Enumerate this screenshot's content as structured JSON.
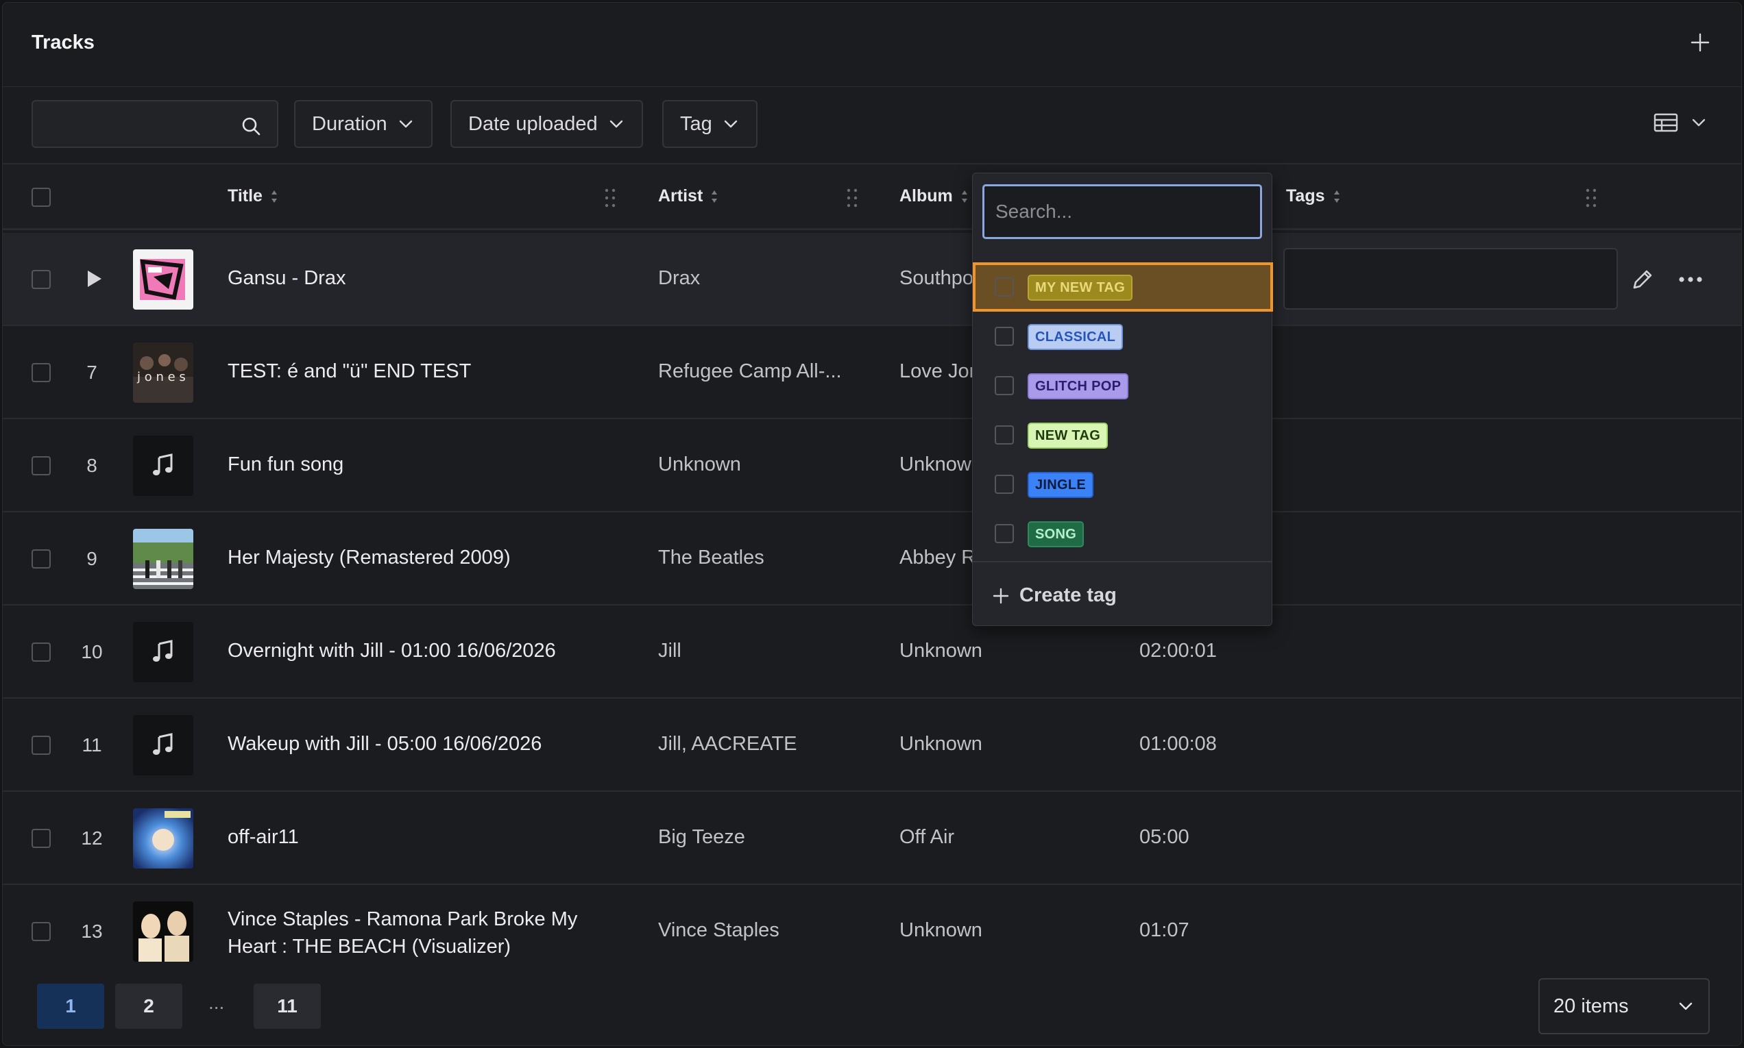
{
  "header": {
    "title": "Tracks"
  },
  "filters": {
    "search_placeholder": "",
    "duration_label": "Duration",
    "date_label": "Date uploaded",
    "tag_label": "Tag"
  },
  "columns": {
    "title": "Title",
    "artist": "Artist",
    "album": "Album",
    "tags": "Tags"
  },
  "rows": [
    {
      "num": "",
      "title": "Gansu - Drax",
      "artist": "Drax",
      "album": "Southpo",
      "duration": "",
      "thumb": "art-pink"
    },
    {
      "num": "7",
      "title": "TEST: é and \"ü\" END TEST",
      "artist": "Refugee Camp All-...",
      "album": "Love Jon",
      "duration": "",
      "thumb": "art-jones"
    },
    {
      "num": "8",
      "title": "Fun fun song",
      "artist": "Unknown",
      "album": "Unknow",
      "duration": "",
      "thumb": "note"
    },
    {
      "num": "9",
      "title": "Her Majesty (Remastered 2009)",
      "artist": "The Beatles",
      "album": "Abbey R",
      "duration": "",
      "thumb": "art-abbey"
    },
    {
      "num": "10",
      "title": "Overnight with Jill - 01:00 16/06/2026",
      "artist": "Jill",
      "album": "Unknown",
      "duration": "02:00:01",
      "thumb": "note"
    },
    {
      "num": "11",
      "title": "Wakeup with Jill - 05:00 16/06/2026",
      "artist": "Jill, AACREATE",
      "album": "Unknown",
      "duration": "01:00:08",
      "thumb": "note"
    },
    {
      "num": "12",
      "title": "off-air11",
      "artist": "Big Teeze",
      "album": "Off Air",
      "duration": "05:00",
      "thumb": "art-teeze"
    },
    {
      "num": "13",
      "title": "Vince Staples - Ramona Park Broke My Heart : THE BEACH (Visualizer)",
      "artist": "Vince Staples",
      "album": "Unknown",
      "duration": "01:07",
      "thumb": "art-vince"
    }
  ],
  "tag_dropdown": {
    "search_placeholder": "Search...",
    "tags": [
      {
        "label": "MY NEW TAG",
        "bg": "#9c8a1f",
        "fg": "#e8d97a",
        "border": "#b8a433"
      },
      {
        "label": "CLASSICAL",
        "bg": "#b9cdf3",
        "fg": "#2756b8",
        "border": "#6d93d9"
      },
      {
        "label": "GLITCH POP",
        "bg": "#a99be9",
        "fg": "#2b1d70",
        "border": "#8b7bd9"
      },
      {
        "label": "NEW TAG",
        "bg": "#d9f5b3",
        "fg": "#1f3b0f",
        "border": "#9ed46a"
      },
      {
        "label": "JINGLE",
        "bg": "#3b82f6",
        "fg": "#0a1a3a",
        "border": "#2563d8"
      },
      {
        "label": "SONG",
        "bg": "#1f6b45",
        "fg": "#b5f0cd",
        "border": "#2f8a5a"
      }
    ],
    "create_label": "Create tag"
  },
  "pagination": {
    "pages": [
      "1",
      "2",
      "11"
    ],
    "ellipsis": "...",
    "items_label": "20 items"
  }
}
